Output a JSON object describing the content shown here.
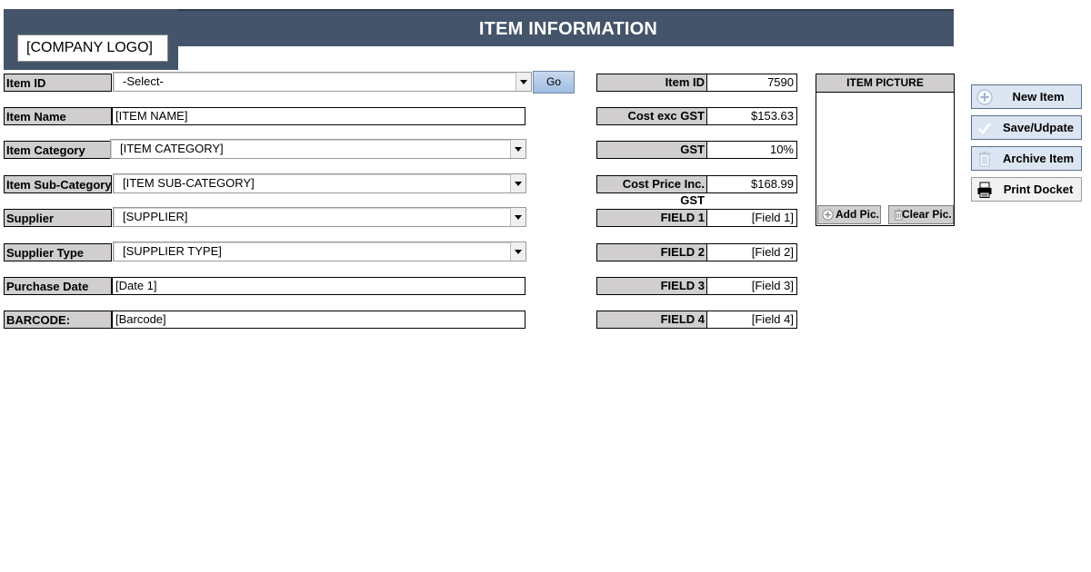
{
  "header": {
    "title": "ITEM INFORMATION",
    "logo_text": "[COMPANY LOGO]",
    "bar_color": "#44546a"
  },
  "form": {
    "item_id": {
      "label": "Item ID",
      "value": "-Select-",
      "go_label": "Go"
    },
    "item_name": {
      "label": "Item Name",
      "value": "[ITEM NAME]"
    },
    "item_category": {
      "label": "Item Category",
      "value": "[ITEM CATEGORY]"
    },
    "item_sub_category": {
      "label": "Item Sub-Category",
      "value": "[ITEM SUB-CATEGORY]"
    },
    "supplier": {
      "label": "Supplier",
      "value": "[SUPPLIER]"
    },
    "supplier_type": {
      "label": "Supplier Type",
      "value": "[SUPPLIER TYPE]"
    },
    "purchase_date": {
      "label": "Purchase Date",
      "value": "[Date 1]"
    },
    "barcode": {
      "label": "BARCODE:",
      "value": "[Barcode]"
    }
  },
  "details": {
    "item_id": {
      "label": "Item ID",
      "value": "7590"
    },
    "cost_exc_gst": {
      "label": "Cost exc GST",
      "value": "$153.63"
    },
    "gst": {
      "label": "GST",
      "value": "10%"
    },
    "cost_inc_gst": {
      "label": "Cost Price Inc. GST",
      "value": "$168.99"
    },
    "field1": {
      "label": "FIELD 1",
      "value": "[Field 1]"
    },
    "field2": {
      "label": "FIELD 2",
      "value": "[Field 2]"
    },
    "field3": {
      "label": "FIELD 3",
      "value": "[Field 3]"
    },
    "field4": {
      "label": "FIELD 4",
      "value": "[Field 4]"
    }
  },
  "picture": {
    "title": "ITEM PICTURE",
    "add_label": "Add Pic.",
    "clear_label": "Clear Pic."
  },
  "actions": {
    "new_item": "New Item",
    "save_update": "Save/Udpate",
    "archive_item": "Archive Item",
    "print_docket": "Print Docket",
    "icons": [
      "plus-circle-icon",
      "checkmark-icon",
      "trash-icon",
      "printer-icon"
    ]
  },
  "colors": {
    "label_bg": "#d0cece",
    "button_bg": "#dce6f2",
    "go_button": "#9fbde2"
  }
}
